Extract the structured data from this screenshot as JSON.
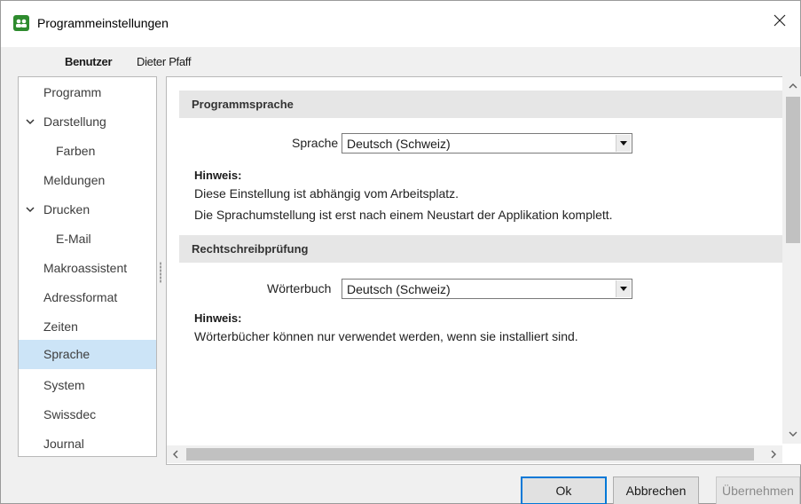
{
  "window": {
    "title": "Programmeinstellungen"
  },
  "user": {
    "label": "Benutzer",
    "name": "Dieter Pfaff"
  },
  "sidebar": {
    "items": [
      {
        "label": "Programm"
      },
      {
        "label": "Darstellung"
      },
      {
        "label": "Farben"
      },
      {
        "label": "Meldungen"
      },
      {
        "label": "Drucken"
      },
      {
        "label": "E-Mail"
      },
      {
        "label": "Makroassistent"
      },
      {
        "label": "Adressformat"
      },
      {
        "label": "Zeiten"
      },
      {
        "label": "Sprache",
        "selected": true
      },
      {
        "label": "System"
      },
      {
        "label": "Swissdec"
      },
      {
        "label": "Journal"
      }
    ]
  },
  "sections": {
    "language": {
      "header": "Programmsprache",
      "field_label": "Sprache",
      "value": "Deutsch (Schweiz)",
      "hint_title": "Hinweis:",
      "hint_lines": [
        "Diese Einstellung ist abhängig vom Arbeitsplatz.",
        "Die Sprachumstellung ist erst nach einem Neustart der Applikation komplett."
      ]
    },
    "spelling": {
      "header": "Rechtschreibprüfung",
      "field_label": "Wörterbuch",
      "value": "Deutsch (Schweiz)",
      "hint_title": "Hinweis:",
      "hint_lines": [
        "Wörterbücher können nur verwendet werden, wenn sie installiert sind."
      ]
    }
  },
  "buttons": {
    "ok": "Ok",
    "cancel": "Abbrechen",
    "apply": "Übernehmen"
  },
  "colors": {
    "selection": "#cce4f7",
    "accent": "#0078d7",
    "app_icon": "#2e8b2e"
  },
  "icons": [
    "app-icon",
    "close-icon",
    "chevron-down-icon",
    "dropdown-arrow-icon",
    "scroll-up-icon",
    "scroll-down-icon",
    "scroll-left-icon",
    "scroll-right-icon"
  ]
}
